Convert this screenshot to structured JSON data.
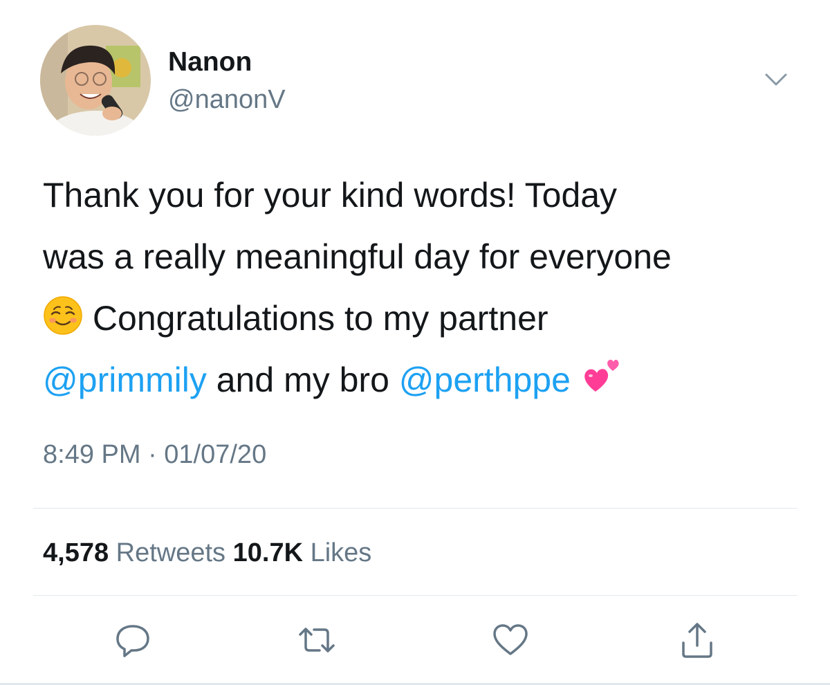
{
  "author": {
    "display_name": "Nanon",
    "handle": "@nanonV",
    "avatar_icon": "avatar-photo"
  },
  "tweet": {
    "line1": "Thank you for your kind words! Today",
    "line2": "was a really meaningful day for everyone",
    "line3_emoji": "smiling-face-icon",
    "line3_text": "Congratulations to my partner",
    "mention1": "@primmily",
    "line4_mid": "and my bro",
    "mention2": "@perthppe",
    "line4_emoji": "two-hearts-icon",
    "timestamp": "8:49 PM · 01/07/20"
  },
  "stats": {
    "retweets_count": "4,578",
    "retweets_label": "Retweets",
    "likes_count": "10.7K",
    "likes_label": "Likes"
  },
  "actions": [
    "reply-icon",
    "retweet-icon",
    "like-icon",
    "share-icon"
  ],
  "colors": {
    "text": "#14171a",
    "secondary": "#657786",
    "link": "#1da1f2",
    "divider": "#e1e8ed"
  }
}
